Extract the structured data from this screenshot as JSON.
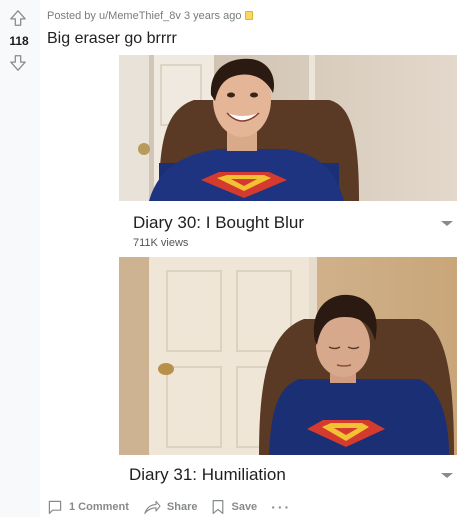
{
  "post": {
    "score": "118",
    "author_line": "Posted by u/MemeThief_8v 3 years ago",
    "title": "Big eraser go brrrr",
    "video_one": {
      "title": "Diary 30: I Bought Blur",
      "views": "711K views"
    },
    "video_two": {
      "title": "Diary 31: Humiliation"
    },
    "actions": {
      "comments": "1 Comment",
      "share": "Share",
      "save": "Save",
      "more": "···"
    }
  },
  "icons": {
    "upvote": "arrow-up-icon",
    "downvote": "arrow-down-icon",
    "award": "award-icon",
    "comment": "comment-icon",
    "share": "share-icon",
    "save": "bookmark-icon",
    "more": "more-icon",
    "dropdown": "caret-down-icon"
  },
  "colors": {
    "vote_column": "#f8f9fa",
    "meta_text": "#787c7e",
    "action_text": "#878a8c",
    "superman_red": "#d53a2f",
    "superman_yellow": "#f1c232",
    "shirt_blue": "#1b2f74"
  }
}
